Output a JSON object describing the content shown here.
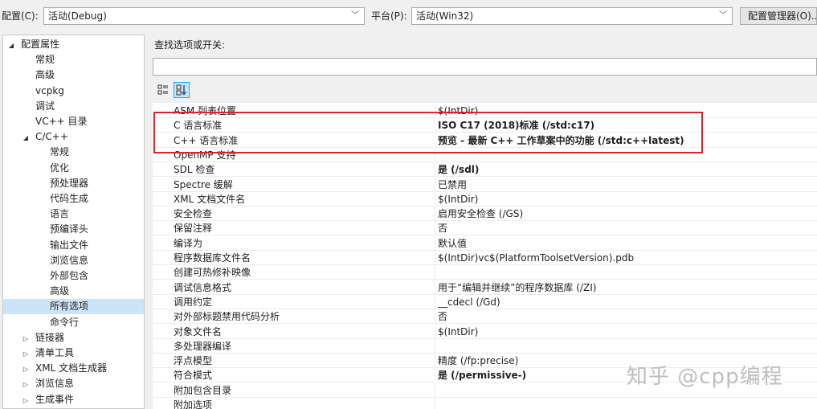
{
  "toolbar": {
    "config_label": "配置(C):",
    "config_value": "活动(Debug)",
    "platform_label": "平台(P):",
    "platform_value": "活动(Win32)",
    "config_manager_label": "配置管理器(O)..."
  },
  "tree": {
    "items": [
      {
        "label": "配置属性",
        "expander": "◢"
      },
      {
        "label": "常规"
      },
      {
        "label": "高级"
      },
      {
        "label": "vcpkg"
      },
      {
        "label": "调试"
      },
      {
        "label": "VC++ 目录"
      },
      {
        "label": "C/C++",
        "expander": "◢"
      },
      {
        "label": "常规"
      },
      {
        "label": "优化"
      },
      {
        "label": "预处理器"
      },
      {
        "label": "代码生成"
      },
      {
        "label": "语言"
      },
      {
        "label": "预编译头"
      },
      {
        "label": "输出文件"
      },
      {
        "label": "浏览信息"
      },
      {
        "label": "外部包含"
      },
      {
        "label": "高级"
      },
      {
        "label": "所有选项",
        "selected": true
      },
      {
        "label": "命令行"
      },
      {
        "label": "链接器",
        "expander": "▷"
      },
      {
        "label": "清单工具",
        "expander": "▷"
      },
      {
        "label": "XML 文档生成器",
        "expander": "▷"
      },
      {
        "label": "浏览信息",
        "expander": "▷"
      },
      {
        "label": "生成事件",
        "expander": "▷"
      }
    ]
  },
  "search": {
    "label": "查找选项或开关:",
    "value": ""
  },
  "view_buttons": {
    "categorized_icon": "categorized-icon",
    "alphabetical_icon": "alphabetical-icon"
  },
  "grid": {
    "rows": [
      {
        "name": "ASM 列表位置",
        "value": "$(IntDir)"
      },
      {
        "name": "C 语言标准",
        "value": "ISO C17 (2018)标准 (/std:c17)",
        "bold": true
      },
      {
        "name": "C++ 语言标准",
        "value": "预览 - 最新 C++ 工作草案中的功能 (/std:c++latest)",
        "bold": true
      },
      {
        "name": "OpenMP 支持",
        "value": ""
      },
      {
        "name": "SDL 检查",
        "value": "是 (/sdl)",
        "bold": true
      },
      {
        "name": "Spectre 缓解",
        "value": "已禁用"
      },
      {
        "name": "XML 文档文件名",
        "value": "$(IntDir)"
      },
      {
        "name": "安全检查",
        "value": "启用安全检查 (/GS)"
      },
      {
        "name": "保留注释",
        "value": "否"
      },
      {
        "name": "编译为",
        "value": "默认值"
      },
      {
        "name": "程序数据库文件名",
        "value": "$(IntDir)vc$(PlatformToolsetVersion).pdb"
      },
      {
        "name": "创建可热修补映像",
        "value": ""
      },
      {
        "name": "调试信息格式",
        "value": "用于“编辑并继续”的程序数据库 (/ZI)"
      },
      {
        "name": "调用约定",
        "value": "__cdecl (/Gd)"
      },
      {
        "name": "对外部标题禁用代码分析",
        "value": "否"
      },
      {
        "name": "对象文件名",
        "value": "$(IntDir)"
      },
      {
        "name": "多处理器编译",
        "value": ""
      },
      {
        "name": "浮点模型",
        "value": "精度 (/fp:precise)"
      },
      {
        "name": "符合模式",
        "value": "是 (/permissive-)",
        "bold": true
      },
      {
        "name": "附加包含目录",
        "value": ""
      },
      {
        "name": "附加选项",
        "value": ""
      }
    ]
  },
  "watermark": "知乎 @cpp编程",
  "colors": {
    "highlight_border": "#d9232e",
    "selection": "#cce4f7"
  }
}
